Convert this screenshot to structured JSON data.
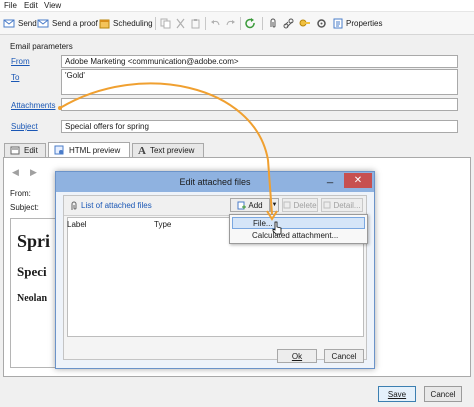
{
  "menu": {
    "file": "File",
    "edit": "Edit",
    "view": "View"
  },
  "toolbar": {
    "send": "Send",
    "send_proof": "Send a proof",
    "scheduling": "Scheduling",
    "properties": "Properties"
  },
  "email_params": {
    "title": "Email parameters",
    "from_label": "From",
    "from_value": "Adobe Marketing <communication@adobe.com>",
    "to_label": "To",
    "to_value": "'Gold'",
    "attachments_label": "Attachments",
    "attachments_value": "",
    "subject_label": "Subject",
    "subject_value": "Special offers for spring"
  },
  "tabs": [
    {
      "label": "Edit",
      "active": false
    },
    {
      "label": "HTML preview",
      "active": true
    },
    {
      "label": "Text preview",
      "active": false
    }
  ],
  "preview": {
    "from_label": "From:",
    "subject_label": "Subject:",
    "heading1": "Spri",
    "heading2": "Speci",
    "text": "Neolan"
  },
  "dialog": {
    "title": "Edit attached files",
    "list_title": "List of attached files",
    "add_label": "Add",
    "delete_label": "Delete",
    "detail_label": "Detail...",
    "columns": [
      "Label",
      "Type"
    ],
    "ok_label": "Ok",
    "cancel_label": "Cancel",
    "add_menu": [
      "File...",
      "Calculated attachment..."
    ]
  },
  "bottom": {
    "save_label": "Save",
    "cancel_label": "Cancel"
  },
  "colors": {
    "accent": "#1a57b5",
    "annotation_arrow": "#f0a030",
    "dialog_title": "#8fb2e0"
  }
}
